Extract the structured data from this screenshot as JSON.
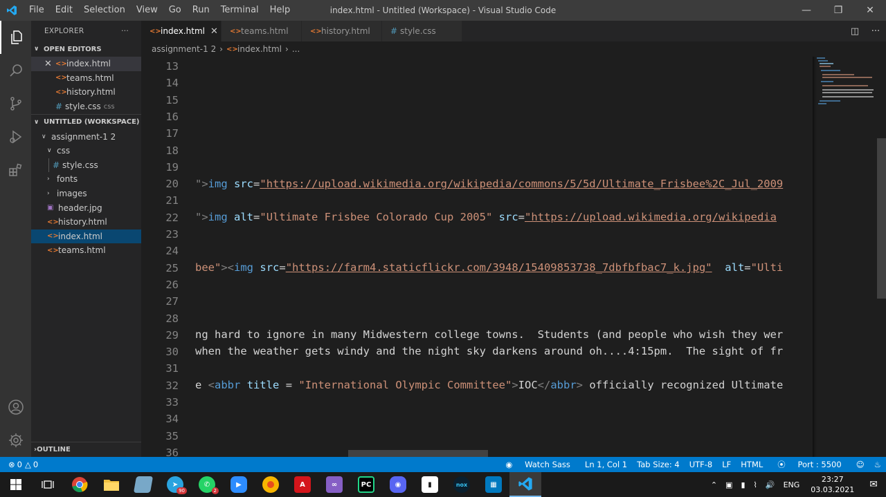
{
  "titlebar": {
    "menu": [
      "File",
      "Edit",
      "Selection",
      "View",
      "Go",
      "Run",
      "Terminal",
      "Help"
    ],
    "title": "index.html - Untitled (Workspace) - Visual Studio Code"
  },
  "sidebar": {
    "header": "EXPLORER",
    "more": "···",
    "open_editors_label": "OPEN EDITORS",
    "open_editors": [
      {
        "name": "index.html",
        "type": "html"
      },
      {
        "name": "teams.html",
        "type": "html"
      },
      {
        "name": "history.html",
        "type": "html"
      },
      {
        "name": "style.css",
        "type": "css",
        "suffix": "css"
      }
    ],
    "workspace_label": "UNTITLED (WORKSPACE)",
    "tree": {
      "root": "assignment-1 2",
      "css_folder": "css",
      "css_file": "style.css",
      "fonts": "fonts",
      "images": "images",
      "files": [
        {
          "name": "header.jpg",
          "type": "img"
        },
        {
          "name": "history.html",
          "type": "html"
        },
        {
          "name": "index.html",
          "type": "html"
        },
        {
          "name": "teams.html",
          "type": "html"
        }
      ]
    },
    "outline_label": "OUTLINE"
  },
  "tabs": [
    {
      "label": "index.html",
      "type": "html"
    },
    {
      "label": "teams.html",
      "type": "html"
    },
    {
      "label": "history.html",
      "type": "html"
    },
    {
      "label": "style.css",
      "type": "css"
    }
  ],
  "breadcrumb": [
    "assignment-1 2",
    "index.html",
    "..."
  ],
  "editor": {
    "line_numbers": [
      "13",
      "14",
      "15",
      "16",
      "17",
      "18",
      "19",
      "20",
      "21",
      "22",
      "23",
      "24",
      "25",
      "26",
      "27",
      "28",
      "29",
      "30",
      "31",
      "32",
      "33",
      "34",
      "35",
      "36"
    ],
    "lines": {
      "l20": {
        "p1": "\">",
        "tag": "img",
        "attr": "src",
        "eq": "=",
        "val": "\"https://upload.wikimedia.org/wikipedia/commons/5/5d/Ultimate_Frisbee%2C_Jul_2009"
      },
      "l22": {
        "p1": "\">",
        "tag": "img",
        "attr1": "alt",
        "val1": "\"Ultimate Frisbee Colorado Cup 2005\"",
        "attr2": "src",
        "val2": "\"https://upload.wikimedia.org/wikipedia"
      },
      "l25": {
        "p0": "bee\"",
        "p1": ">",
        "tag": "img",
        "attr1": "src",
        "val1": "\"https://farm4.staticflickr.com/3948/15409853738_7dbfbfbac7_k.jpg\"",
        "attr2": "alt",
        "val2": "\"Ulti"
      },
      "l29": "ng hard to ignore in many Midwestern college towns.  Students (and people who wish they wer",
      "l30": "when the weather gets windy and the night sky darkens around oh....4:15pm.  The sight of fr",
      "l32": {
        "p0": "e ",
        "tag": "abbr",
        "attr": "title",
        "eq": " = ",
        "val": "\"International Olympic Committee\"",
        "text": "IOC",
        "close": "abbr",
        "rest": " officially recognized Ultimate"
      }
    }
  },
  "statusbar": {
    "errors": "0",
    "warnings": "0",
    "watch_sass": "Watch Sass",
    "position": "Ln 1, Col 1",
    "tab_size": "Tab Size: 4",
    "encoding": "UTF-8",
    "eol": "LF",
    "language": "HTML",
    "port": "Port : 5500"
  },
  "taskbar": {
    "telegram_badge": "90",
    "whatsapp_badge": "2",
    "lang": "ENG",
    "time": "23:27",
    "date": "03.03.2021"
  },
  "colors": {
    "accent": "#007acc",
    "html_icon": "#e37933",
    "css_icon": "#519aba"
  }
}
